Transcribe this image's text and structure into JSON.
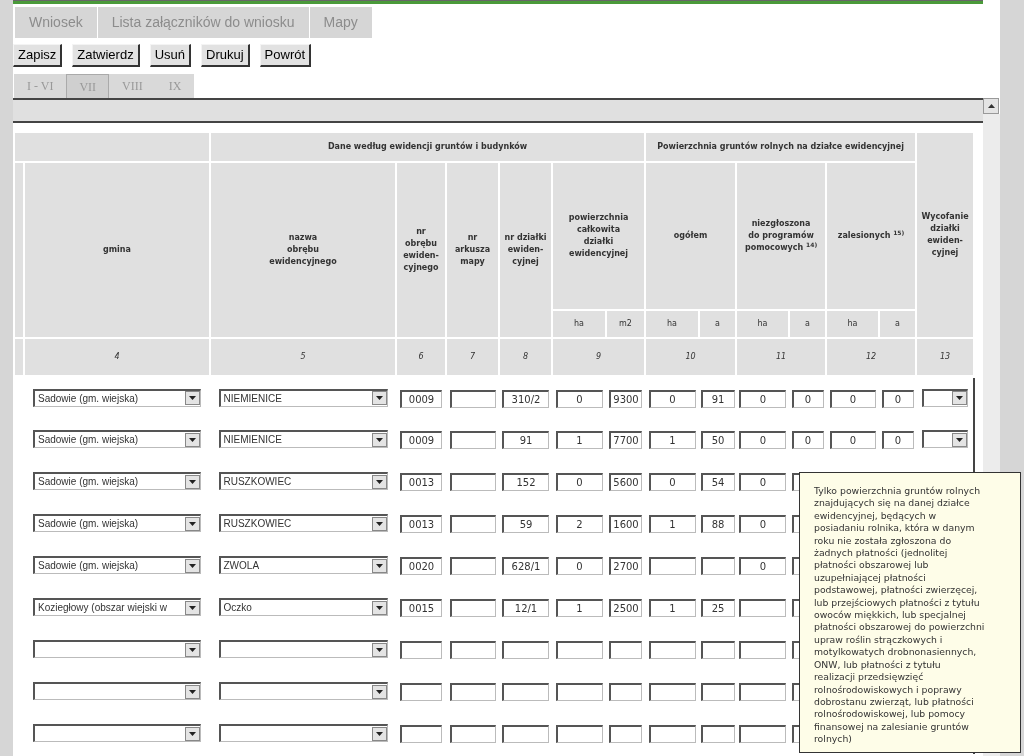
{
  "tabs": [
    "Wniosek",
    "Lista załączników do wniosku",
    "Mapy"
  ],
  "buttons": [
    "Zapisz",
    "Zatwierdz",
    "Usuń",
    "Drukuj",
    "Powrót"
  ],
  "section_tabs": [
    {
      "label": "I - VI",
      "selected": false
    },
    {
      "label": "VII",
      "selected": true
    },
    {
      "label": "VIII",
      "selected": false
    },
    {
      "label": "IX",
      "selected": false
    }
  ],
  "table": {
    "group_headers": [
      "Dane według ewidencji gruntów i budynków",
      "Powierzchnia gruntów rolnych na działce ewidencyjnej"
    ],
    "columns": [
      "gmina",
      "nazwa\nobrębu\newidencyjnego",
      "nr\nobrębu\newiden-\ncyjnego",
      "nr\narkusza\nmapy",
      "nr działki\newiden-\ncyjnej",
      "powierzchnia\ncałkowita\ndziałki\newidencyjnej",
      "ogółem",
      "niezgłoszona\ndo programów\npomocowych $^{14)}$",
      "zalesionych $^{15)}$",
      "Wycofanie\ndziałki\newiden-\ncyjnej"
    ],
    "units": [
      "ha",
      "m2",
      "ha",
      "a",
      "ha",
      "a",
      "ha",
      "a"
    ],
    "numbers": [
      "4",
      "5",
      "6",
      "7",
      "8",
      "9",
      "10",
      "11",
      "12",
      "13"
    ],
    "rows": [
      {
        "gmina": "Sadowie (gm. wiejska)",
        "obreb_nazwa": "NIEMIENICE",
        "obreb_nr": "0009",
        "dzialka": "310/2",
        "calk_ha": "0",
        "calk_m2": "9300",
        "ogolem_ha": "0",
        "ogolem_a": "91",
        "niezgl_ha": "0",
        "niezgl_a": "0",
        "zales_ha": "0",
        "zales_a": "0"
      },
      {
        "gmina": "Sadowie (gm. wiejska)",
        "obreb_nazwa": "NIEMIENICE",
        "obreb_nr": "0009",
        "dzialka": "91",
        "calk_ha": "1",
        "calk_m2": "7700",
        "ogolem_ha": "1",
        "ogolem_a": "50",
        "niezgl_ha": "0",
        "niezgl_a": "0",
        "zales_ha": "0",
        "zales_a": "0"
      },
      {
        "gmina": "Sadowie (gm. wiejska)",
        "obreb_nazwa": "RUSZKOWIEC",
        "obreb_nr": "0013",
        "dzialka": "152",
        "calk_ha": "0",
        "calk_m2": "5600",
        "ogolem_ha": "0",
        "ogolem_a": "54",
        "niezgl_ha": "0"
      },
      {
        "gmina": "Sadowie (gm. wiejska)",
        "obreb_nazwa": "RUSZKOWIEC",
        "obreb_nr": "0013",
        "dzialka": "59",
        "calk_ha": "2",
        "calk_m2": "1600",
        "ogolem_ha": "1",
        "ogolem_a": "88",
        "niezgl_ha": "0"
      },
      {
        "gmina": "Sadowie (gm. wiejska)",
        "obreb_nazwa": "ZWOLA",
        "obreb_nr": "0020",
        "dzialka": "628/1",
        "calk_ha": "0",
        "calk_m2": "2700",
        "niezgl_ha": "0"
      },
      {
        "gmina": "Koziegłowy (obszar wiejski w",
        "obreb_nazwa": "Oczko",
        "obreb_nr": "0015",
        "dzialka": "12/1",
        "calk_ha": "1",
        "calk_m2": "2500",
        "ogolem_ha": "1",
        "ogolem_a": "25"
      },
      {},
      {},
      {}
    ]
  },
  "tooltip": "Tylko powierzchnia gruntów rolnych\nznajdujących się na danej działce\newidencyjnej, będących w\nposiadaniu rolnika, która w danym\nroku nie została zgłoszona do\nżadnych płatności (jednolitej\npłatności obszarowej lub\nuzupełniającej płatności\npodstawowej, płatności zwierzęcej,\nlub przejściowych płatności z tytułu\nowoców miękkich, lub specjalnej\npłatności obszarowej do powierzchni\nupraw roślin strączkowych i\nmotylkowatych drobnonasiennych,\nONW, lub płatności z tytułu\nrealizacji przedsięwzięć\nrolnośrodowiskowych i poprawy\ndobrostanu zwierząt, lub płatności\nrolnośrodowiskowej, lub pomocy\nfinansowej na zalesianie gruntów\nrolnych)"
}
